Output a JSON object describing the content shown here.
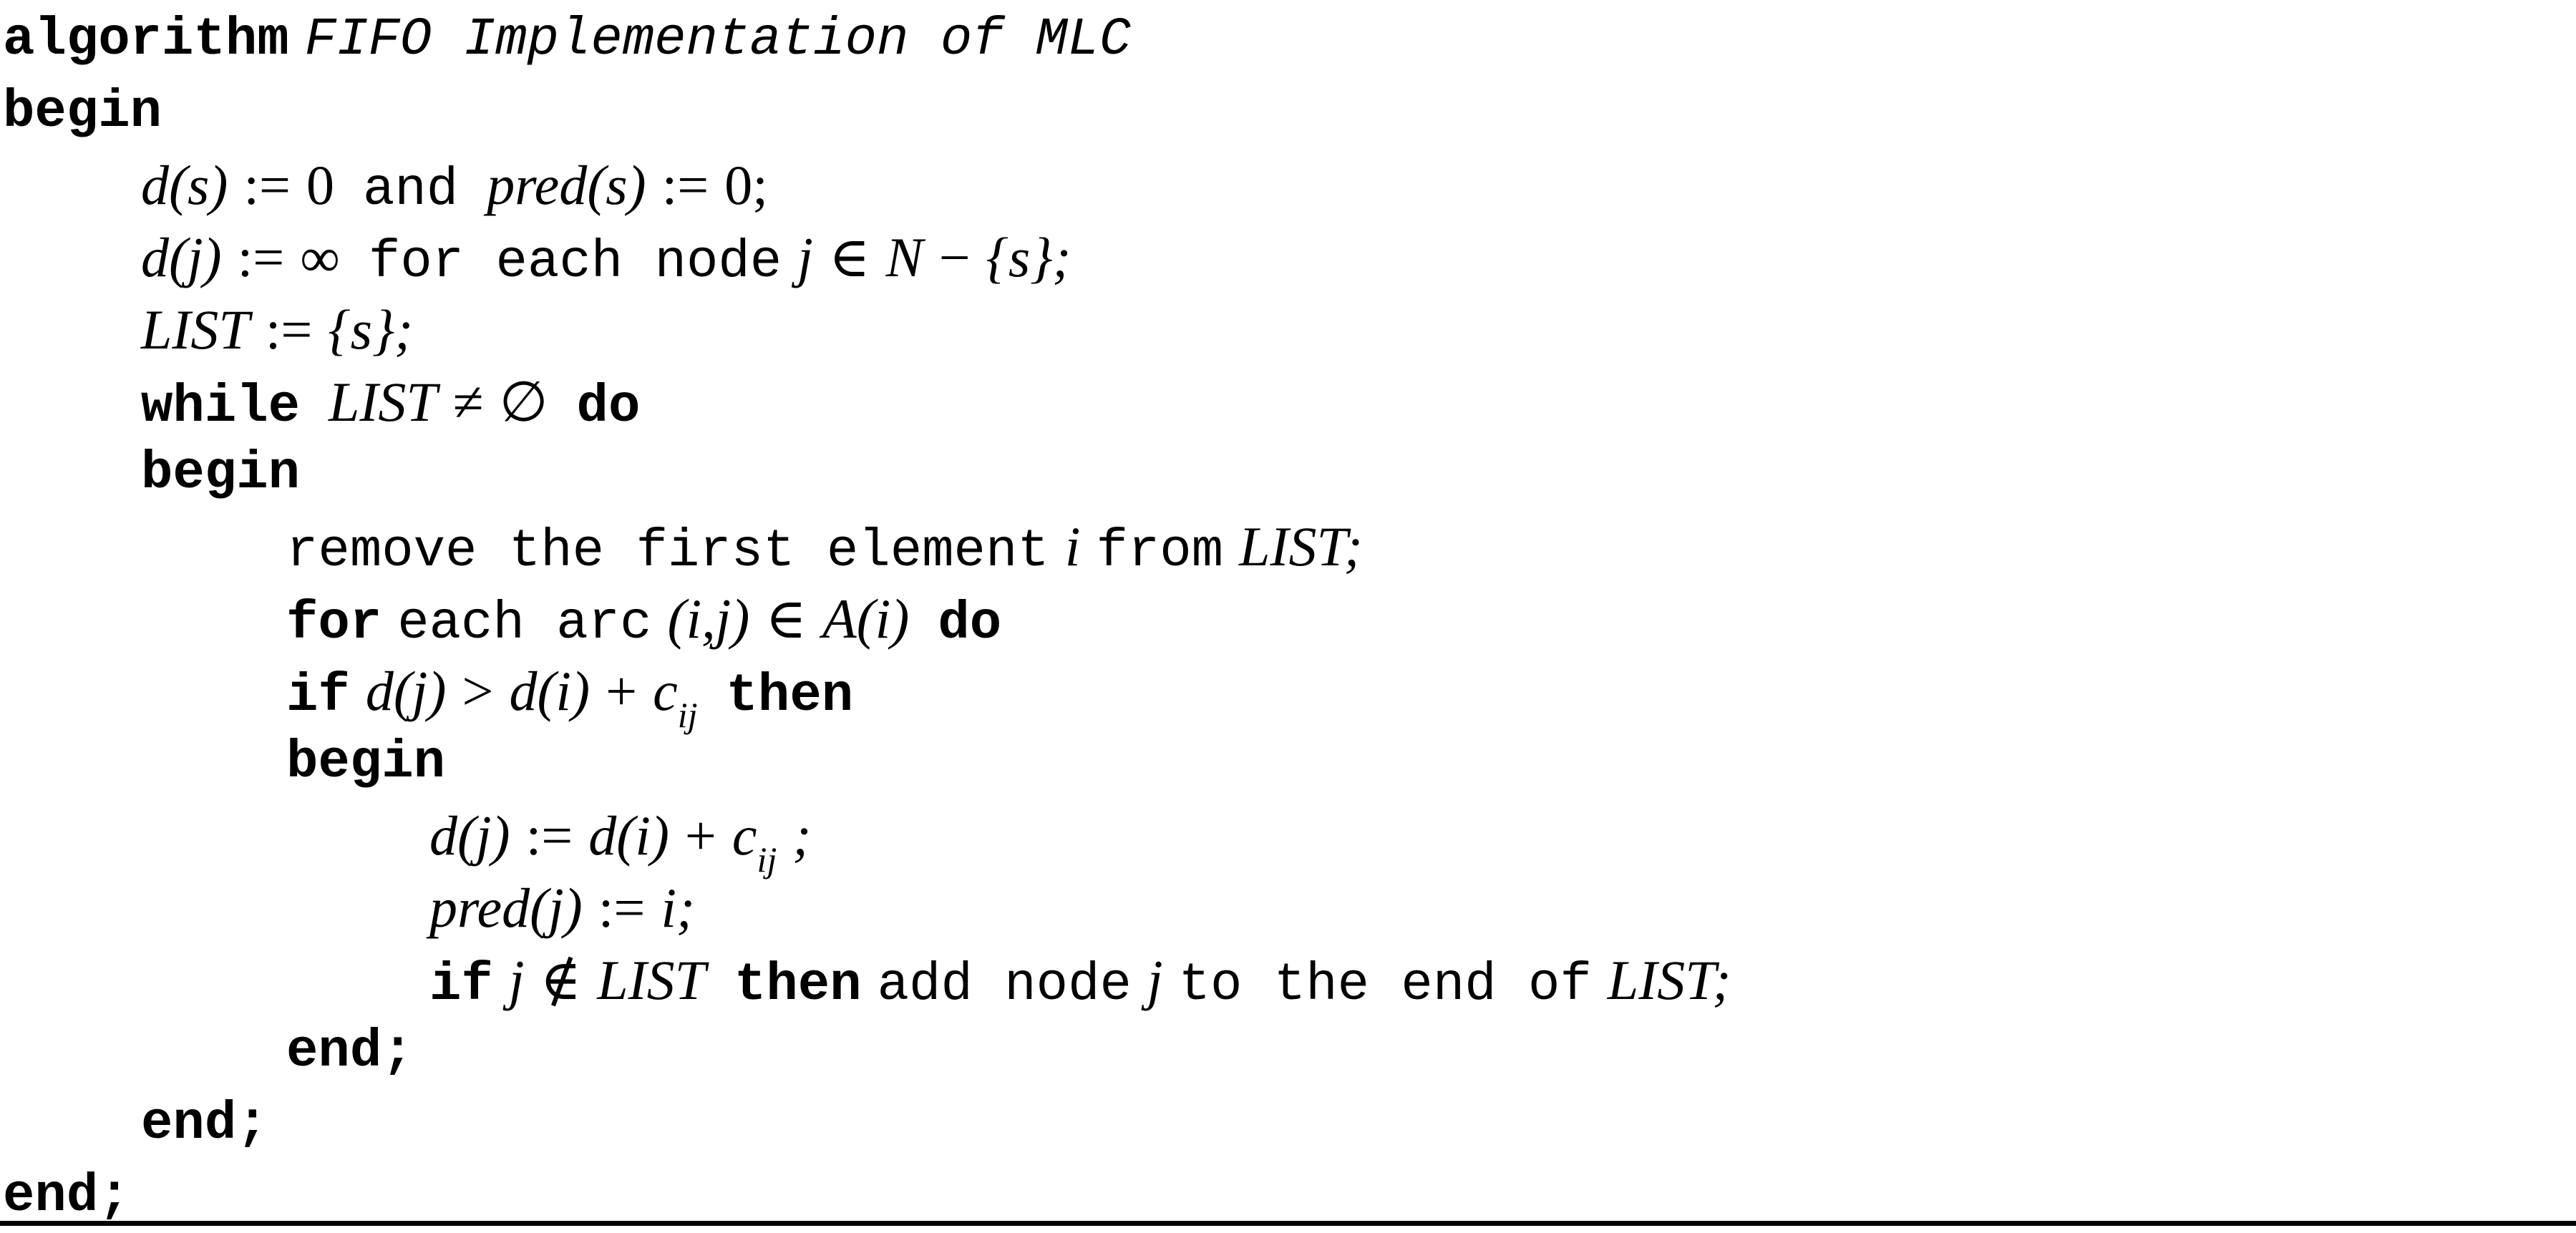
{
  "algorithm": {
    "keyword": "algorithm",
    "title": "FIFO Implementation of MLC",
    "open_keyword": "begin",
    "close_keyword": "end;",
    "rule_color": "#000000",
    "text_color": "#000000",
    "background_color": "#ffffff"
  },
  "lines": {
    "l1_kw": "algorithm",
    "l1_title": "FIFO Implementation of MLC",
    "l2_begin": "begin",
    "l3_d": "d",
    "l3_s1": "(s)",
    "l3_assign1": ":=",
    "l3_zero1": "0",
    "l3_and": "and",
    "l3_pred": "pred",
    "l3_s2": "(s)",
    "l3_assign2": ":=",
    "l3_zero2": "0;",
    "l4_d": "d",
    "l4_j": "(j)",
    "l4_assign": ":=",
    "l4_inf": "∞",
    "l4_for_each_node": "for each node",
    "l4_jvar": "j",
    "l4_in": "∈",
    "l4_N": "N",
    "l4_minus": "−",
    "l4_set_s": "{s};",
    "l5_list": "LIST",
    "l5_assign": ":=",
    "l5_set_s": "{s};",
    "l6_while": "while",
    "l6_list": "LIST",
    "l6_neq": "≠",
    "l6_empty": "∅",
    "l6_do": "do",
    "l7_begin": "begin",
    "l8_remove": "remove the first element",
    "l8_i": "i",
    "l8_from": "from",
    "l8_list": "LIST",
    "l8_semi": ";",
    "l9_for": "for",
    "l9_each_arc": "each arc",
    "l9_pair": "(i,j)",
    "l9_in": "∈",
    "l9_A": "A",
    "l9_i": "(i)",
    "l9_do": "do",
    "l10_if": "if",
    "l10_dj": "d",
    "l10_j": "(j)",
    "l10_gt": ">",
    "l10_di": "d",
    "l10_i": "(i)",
    "l10_plus": "+",
    "l10_c": "c",
    "l10_ij": "ij",
    "l10_then": "then",
    "l11_begin": "begin",
    "l12_dj": "d",
    "l12_j": "(j)",
    "l12_assign": ":=",
    "l12_di": "d",
    "l12_i": "(i)",
    "l12_plus": "+",
    "l12_c": "c",
    "l12_ij": "ij",
    "l12_semi": ";",
    "l13_pred": "pred",
    "l13_j": "(j)",
    "l13_assign": ":=",
    "l13_i": "i;",
    "l14_if": "if",
    "l14_j": "j",
    "l14_notin": "∉",
    "l14_list": "LIST",
    "l14_then": "then",
    "l14_add_node": "add node",
    "l14_j2": "j",
    "l14_to_end": "to the end of",
    "l14_list2": "LIST",
    "l14_semi": ";",
    "l15_end": "end;",
    "l16_end": "end;",
    "l17_end": "end;"
  }
}
